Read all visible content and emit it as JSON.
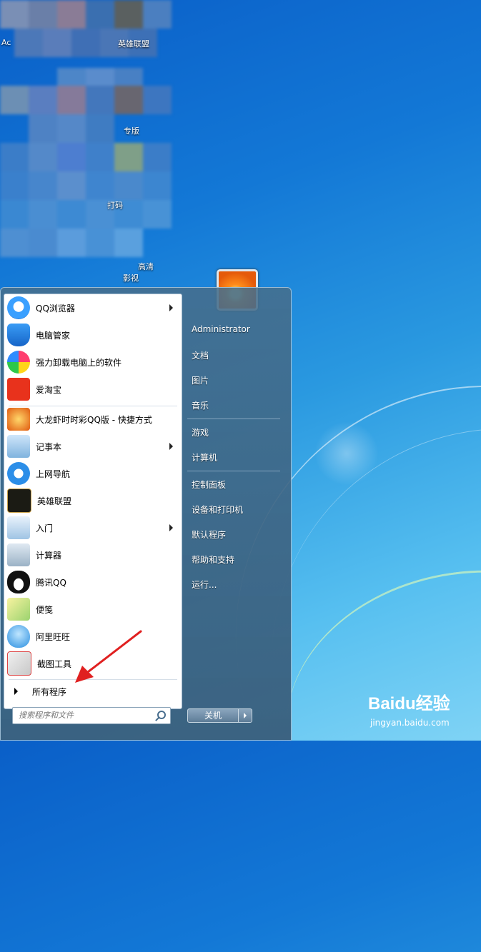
{
  "desktop": {
    "labels": [
      "Ac",
      "英雄联盟",
      "专版",
      "打码",
      "高清",
      "影视"
    ]
  },
  "start_menu": {
    "programs": [
      {
        "label": "QQ浏览器",
        "icon": "qq-browser-icon",
        "submenu": true
      },
      {
        "label": "电脑管家",
        "icon": "pc-manager-shield-icon",
        "submenu": false
      },
      {
        "label": "强力卸载电脑上的软件",
        "icon": "uninstall-clover-icon",
        "submenu": false
      },
      {
        "label": "爱淘宝",
        "icon": "taobao-icon",
        "submenu": false
      },
      {
        "label": "大龙虾时时彩QQ版 - 快捷方式",
        "icon": "lottery-app-icon",
        "submenu": false
      },
      {
        "label": "记事本",
        "icon": "notepad-icon",
        "submenu": true
      },
      {
        "label": "上网导航",
        "icon": "internet-explorer-icon",
        "submenu": false
      },
      {
        "label": "英雄联盟",
        "icon": "league-of-legends-icon",
        "submenu": false
      },
      {
        "label": "入门",
        "icon": "getting-started-icon",
        "submenu": true
      },
      {
        "label": "计算器",
        "icon": "calculator-icon",
        "submenu": false
      },
      {
        "label": "腾讯QQ",
        "icon": "qq-penguin-icon",
        "submenu": false
      },
      {
        "label": "便笺",
        "icon": "sticky-notes-icon",
        "submenu": false
      },
      {
        "label": "阿里旺旺",
        "icon": "aliwangwang-icon",
        "submenu": false
      },
      {
        "label": "截图工具",
        "icon": "snipping-tool-icon",
        "submenu": false
      }
    ],
    "all_programs": "所有程序",
    "search_placeholder": "搜索程序和文件",
    "right_links": [
      "Administrator",
      "文档",
      "图片",
      "音乐",
      "游戏",
      "计算机",
      "控制面板",
      "设备和打印机",
      "默认程序",
      "帮助和支持",
      "运行..."
    ],
    "shutdown_label": "关机"
  },
  "watermark": {
    "logo": "Baidu经验",
    "url": "jingyan.baidu.com"
  },
  "colors": {
    "desktop_blue": "#1378d6",
    "menu_glass": "#466e8c",
    "annotation_red": "#e02020"
  }
}
